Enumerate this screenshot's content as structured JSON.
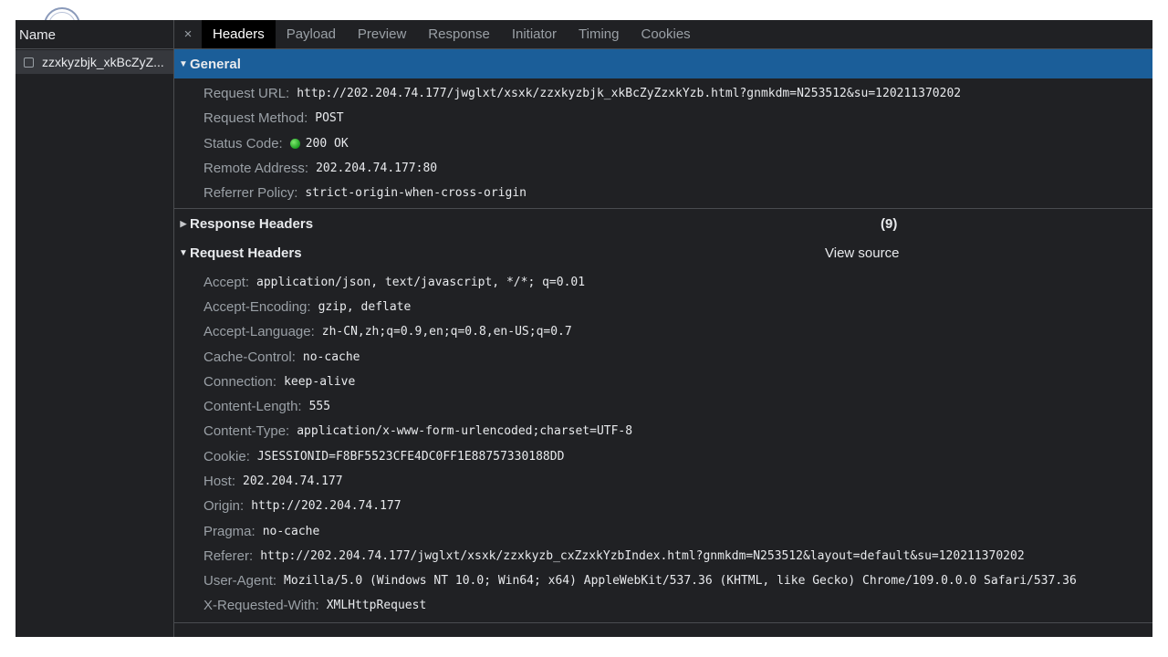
{
  "colors": {
    "panel_bg": "#202124",
    "selected_section": "#1b5e99",
    "active_tab": "#000000",
    "key_text": "#9aa0a6",
    "value_text": "#e8eaed",
    "status_ok": "#1c9e22"
  },
  "request_list": {
    "column_header": "Name",
    "rows": [
      {
        "name": "zzxkyzbjk_xkBcZyZ..."
      }
    ]
  },
  "tabs": {
    "close_icon": "×",
    "items": [
      {
        "label": "Headers",
        "active": true
      },
      {
        "label": "Payload"
      },
      {
        "label": "Preview"
      },
      {
        "label": "Response"
      },
      {
        "label": "Initiator"
      },
      {
        "label": "Timing"
      },
      {
        "label": "Cookies"
      }
    ]
  },
  "general": {
    "title": "General",
    "fields": [
      {
        "key": "Request URL:",
        "value": "http://202.204.74.177/jwglxt/xsxk/zzxkyzbjk_xkBcZyZzxkYzb.html?gnmkdm=N253512&su=120211370202"
      },
      {
        "key": "Request Method:",
        "value": "POST"
      },
      {
        "key": "Status Code:",
        "value": "200 OK",
        "icon": "green-status-dot"
      },
      {
        "key": "Remote Address:",
        "value": "202.204.74.177:80"
      },
      {
        "key": "Referrer Policy:",
        "value": "strict-origin-when-cross-origin"
      }
    ]
  },
  "response_headers": {
    "title": "Response Headers",
    "count": "(9)"
  },
  "request_headers": {
    "title": "Request Headers",
    "view_source": "View source",
    "fields": [
      {
        "key": "Accept:",
        "value": "application/json, text/javascript, */*; q=0.01"
      },
      {
        "key": "Accept-Encoding:",
        "value": "gzip, deflate"
      },
      {
        "key": "Accept-Language:",
        "value": "zh-CN,zh;q=0.9,en;q=0.8,en-US;q=0.7"
      },
      {
        "key": "Cache-Control:",
        "value": "no-cache"
      },
      {
        "key": "Connection:",
        "value": "keep-alive"
      },
      {
        "key": "Content-Length:",
        "value": "555"
      },
      {
        "key": "Content-Type:",
        "value": "application/x-www-form-urlencoded;charset=UTF-8"
      },
      {
        "key": "Cookie:",
        "value": "JSESSIONID=F8BF5523CFE4DC0FF1E88757330188DD"
      },
      {
        "key": "Host:",
        "value": "202.204.74.177"
      },
      {
        "key": "Origin:",
        "value": "http://202.204.74.177"
      },
      {
        "key": "Pragma:",
        "value": "no-cache"
      },
      {
        "key": "Referer:",
        "value": "http://202.204.74.177/jwglxt/xsxk/zzxkyzb_cxZzxkYzbIndex.html?gnmkdm=N253512&layout=default&su=120211370202"
      },
      {
        "key": "User-Agent:",
        "value": "Mozilla/5.0 (Windows NT 10.0; Win64; x64) AppleWebKit/537.36 (KHTML, like Gecko) Chrome/109.0.0.0 Safari/537.36"
      },
      {
        "key": "X-Requested-With:",
        "value": "XMLHttpRequest"
      }
    ]
  }
}
